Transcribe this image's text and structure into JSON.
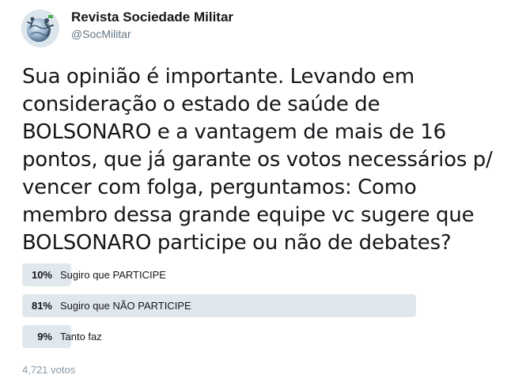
{
  "account": {
    "display_name": "Revista Sociedade Militar",
    "handle": "@SocMilitar"
  },
  "tweet": {
    "text": "Sua opinião é importante. Levando em consideração o estado de saúde de BOLSONARO e a vantagem de mais de 16 pontos, que já garante os votos necessários p/ vencer com folga, perguntamos: Como membro dessa grande equipe vc sugere que BOLSONARO participe ou não de debates?"
  },
  "poll": {
    "choices": [
      {
        "percent_label": "10%",
        "label": "Sugiro que PARTICIPE",
        "percent": 10
      },
      {
        "percent_label": "81%",
        "label": "Sugiro que NÃO PARTICIPE",
        "percent": 81
      },
      {
        "percent_label": "9%",
        "label": "Tanto faz",
        "percent": 9
      }
    ],
    "votes_label": "4,721 votos"
  },
  "colors": {
    "bar": "#e1e8ed",
    "text": "#14171a",
    "secondary": "#657786",
    "muted": "#8899a6"
  }
}
